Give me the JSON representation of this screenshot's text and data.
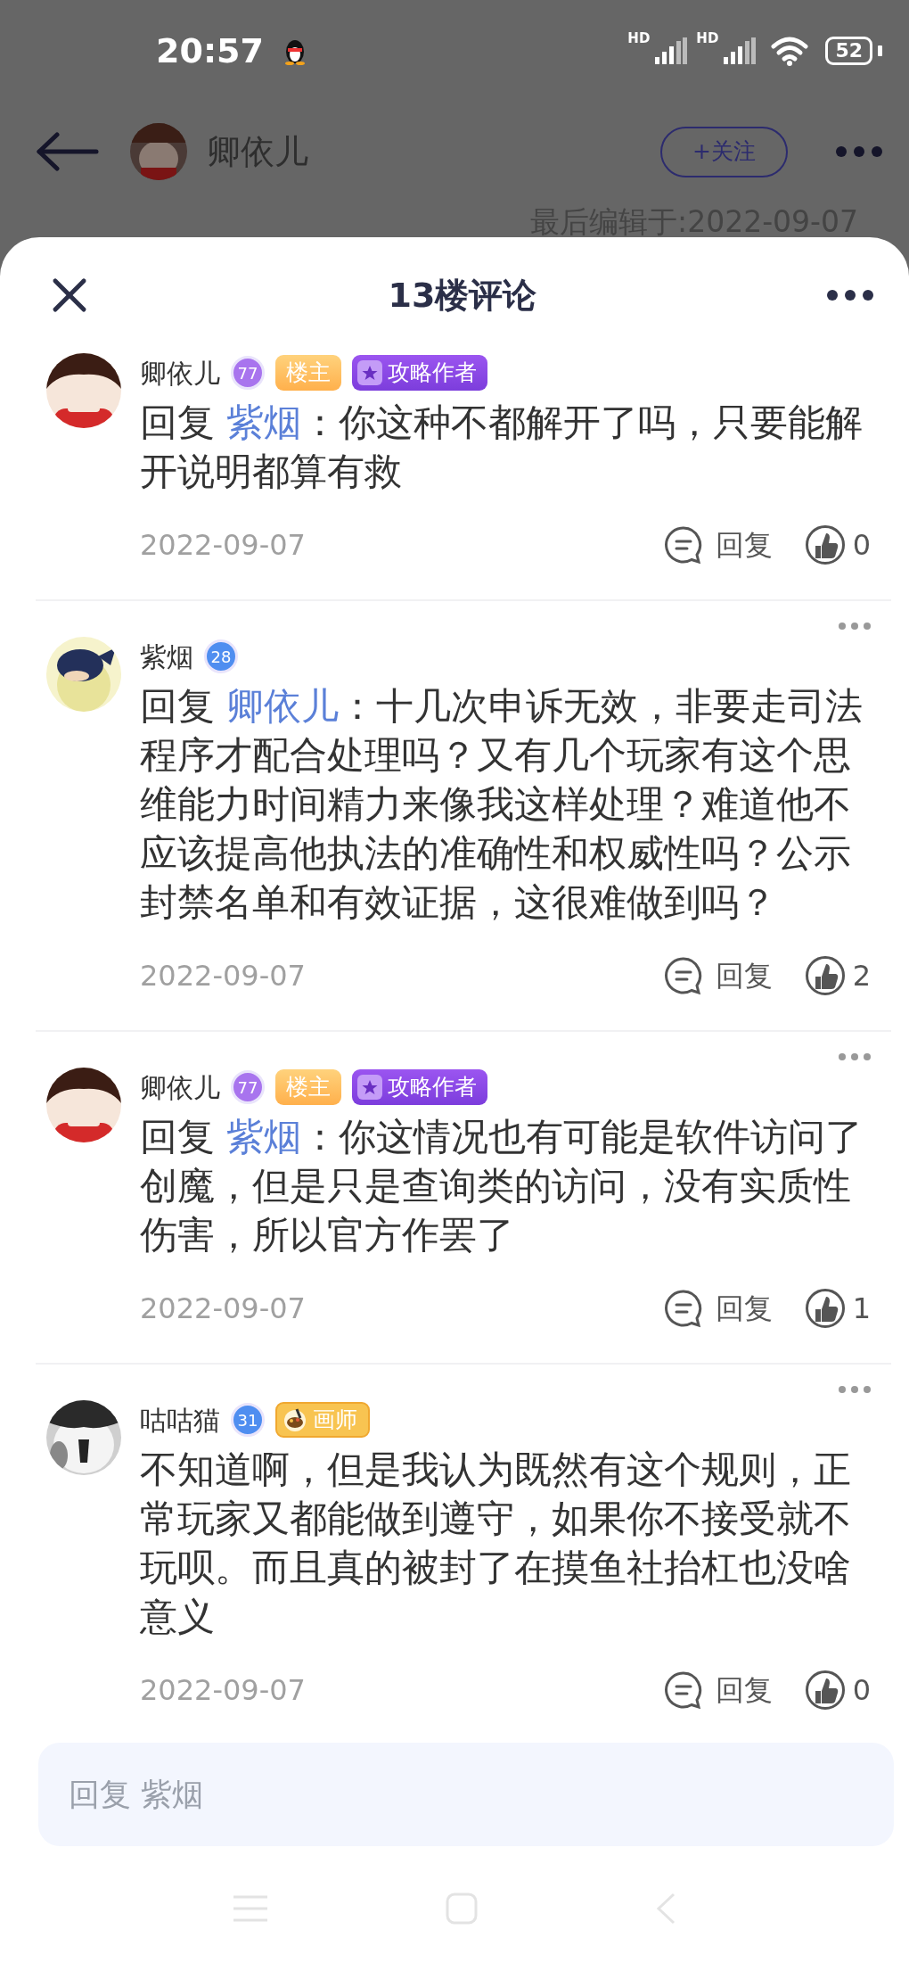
{
  "status_bar": {
    "time": "20:57",
    "network_labels": [
      "HD",
      "HD"
    ],
    "battery": "52"
  },
  "background_page": {
    "author": "卿依儿",
    "follow_button": "+关注",
    "edit_time": "最后编辑于:2022-09-07"
  },
  "sheet": {
    "title": "13楼评论"
  },
  "comments": [
    {
      "user": "卿依儿",
      "avatar": {
        "kind": "girl"
      },
      "level": {
        "value": "77",
        "color": "#a874ee"
      },
      "badges": [
        {
          "kind": "host",
          "label": "楼主"
        },
        {
          "kind": "guide",
          "label": "攻略作者"
        }
      ],
      "reply_label": "回复",
      "reply_to": "紫烟",
      "text": "：你这种不都解开了吗，只要能解开说明都算有救",
      "date": "2022-09-07",
      "reply_button": "回复",
      "likes": "0"
    },
    {
      "more_menu": true,
      "user": "紫烟",
      "avatar": {
        "kind": "fish"
      },
      "level": {
        "value": "28",
        "color": "#4f8ef0"
      },
      "reply_label": "回复",
      "reply_to": "卿依儿",
      "text": "：十几次申诉无效，非要走司法程序才配合处理吗？又有几个玩家有这个思维能力时间精力来像我这样处理？难道他不应该提高他执法的准确性和权威性吗？公示封禁名单和有效证据，这很难做到吗？",
      "date": "2022-09-07",
      "reply_button": "回复",
      "likes": "2"
    },
    {
      "user": "卿依儿",
      "avatar": {
        "kind": "girl"
      },
      "level": {
        "value": "77",
        "color": "#a874ee"
      },
      "badges": [
        {
          "kind": "host",
          "label": "楼主"
        },
        {
          "kind": "guide",
          "label": "攻略作者"
        }
      ],
      "more_menu": true,
      "reply_label": "回复",
      "reply_to": "紫烟",
      "text": "：你这情况也有可能是软件访问了创魔，但是只是查询类的访问，没有实质性伤害，所以官方作罢了",
      "date": "2022-09-07",
      "reply_button": "回复",
      "likes": "1"
    },
    {
      "more_menu": true,
      "user": "咕咕猫",
      "avatar": {
        "kind": "cat"
      },
      "level": {
        "value": "31",
        "color": "#4f8ef0"
      },
      "badges": [
        {
          "kind": "artist",
          "label": "画师"
        }
      ],
      "text": "不知道啊，但是我认为既然有这个规则，正常玩家又都能做到遵守，如果你不接受就不玩呗。而且真的被封了在摸鱼社抬杠也没啥意义",
      "date": "2022-09-07",
      "reply_button": "回复",
      "likes": "0"
    }
  ],
  "reply_box": {
    "placeholder": "回复 紫烟"
  }
}
